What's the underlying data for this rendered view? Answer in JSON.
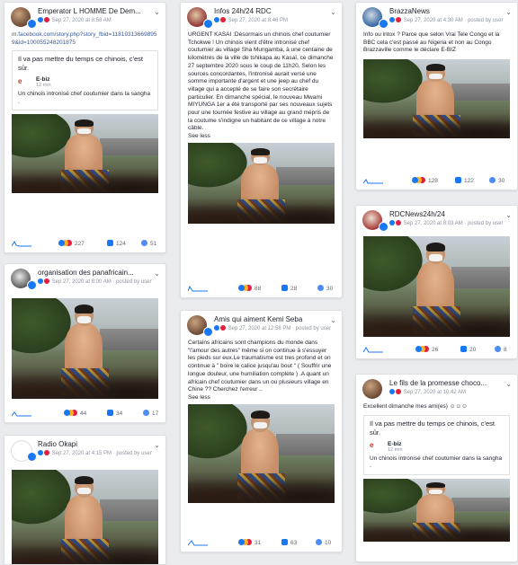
{
  "posts": [
    {
      "author": "Emperator L HOMME De Dem...",
      "date": "Sep 27, 2020 at 8:58 AM",
      "link": "m.facebook.com/story.php?story_fbid=118193136698959&id=100055248201875",
      "quote": "Il va pas mettre du temps ce chinois, c'est sûr.",
      "embed_name": "E-biz",
      "embed_time": "12 min",
      "embed_text": "Un chinois intronisé chef coutumier dans la sangha .",
      "reactions": "227",
      "comments": "124",
      "shares": "51"
    },
    {
      "author": "organisation des panafricain...",
      "date": "Sep 27, 2020 at 8:00 AM",
      "posted_by": "posted by user",
      "reactions": "44",
      "comments": "34",
      "shares": "17"
    },
    {
      "author": "Radio Okapi",
      "date": "Sep 27, 2020 at 4:15 PM",
      "posted_by": "posted by user"
    },
    {
      "author": "Infos 24h/24 RDC",
      "date": "Sep 27, 2020 at 8:46 PM",
      "text": "URGENT KASAI :Désormais un chinois chef coutumier Tchokwe ! Un chinois vient d'être intronisé chef coutumier au village Sha Mungamba, à une centaine de kilomètres de la ville de tshikapa au Kasaï, ce dimanche 27 septembre 2020 sous le coup de 11h20. Selon les sources concordantes, l'intronisé aurait versé une somme importante d'argent et une jeep au chef du village qui a accepté de se faire son secrétaire particulier. En dimanche spécial, le nouveau Mwami MIYUNGA 1er a été transporté par ses nouveaux sujets pour une tournée festive au village au grand mépris de la coutume s'indigne un habitant de ce village à notre câble.",
      "see_less": "See less",
      "reactions": "88",
      "comments": "28",
      "shares": "30"
    },
    {
      "author": "Amis qui aiment Kemi Seba",
      "date": "Sep 27, 2020 at 12:58 PM",
      "posted_by": "posted by user",
      "text": "Certains africains sont champions du monde dans \"l'amour des autres\" même si on continue à s'essuyer les pieds sur eux.Le traumatisme est tres profond et on continue à \" boire le calice jusqu'au bout \" ( Souffrir une longue douleur, une humiliation complète ) .A quant un africain chef coutumier dans un ou plusieurs village en Chine ?? Cherchez l'erreur ..",
      "see_less": "See less",
      "reactions": "31",
      "comments": "63",
      "shares": "10"
    },
    {
      "author": "BrazzaNews",
      "date": "Sep 27, 2020 at 4:30 AM",
      "posted_by": "posted by user",
      "text": "Info ou intox ? Parce que selon Vrai Tele Congo et la BBC cela c'est passé au Nigeria et non au Congo Brazzaville comme le déclare E-BIZ",
      "reactions": "128",
      "comments": "122",
      "shares": "30"
    },
    {
      "author": "RDCNews24h/24",
      "date": "Sep 27, 2020 at 8:03 AM",
      "posted_by": "posted by user",
      "reactions": "26",
      "comments": "20",
      "shares": "8"
    },
    {
      "author": "Le fils de la promesse choco...",
      "date": "Sep 27, 2020 at 10:42 AM",
      "text": "Excellent dimanche mes ami(es) ☺☺☺",
      "quote": "Il va pas mettre du temps ce chinois, c'est sûr.",
      "embed_name": "E-biz",
      "embed_time": "12 min",
      "embed_text": "Un chinois intronisé chef coutumier dans la sangha ."
    }
  ],
  "icons": {
    "menu": "chevron-down-icon",
    "reactions": "reactions-icon",
    "comments": "comment-icon",
    "shares": "share-icon"
  },
  "colors": {
    "background": "#e9ebee",
    "link": "#385898",
    "accent": "#1877f2"
  }
}
